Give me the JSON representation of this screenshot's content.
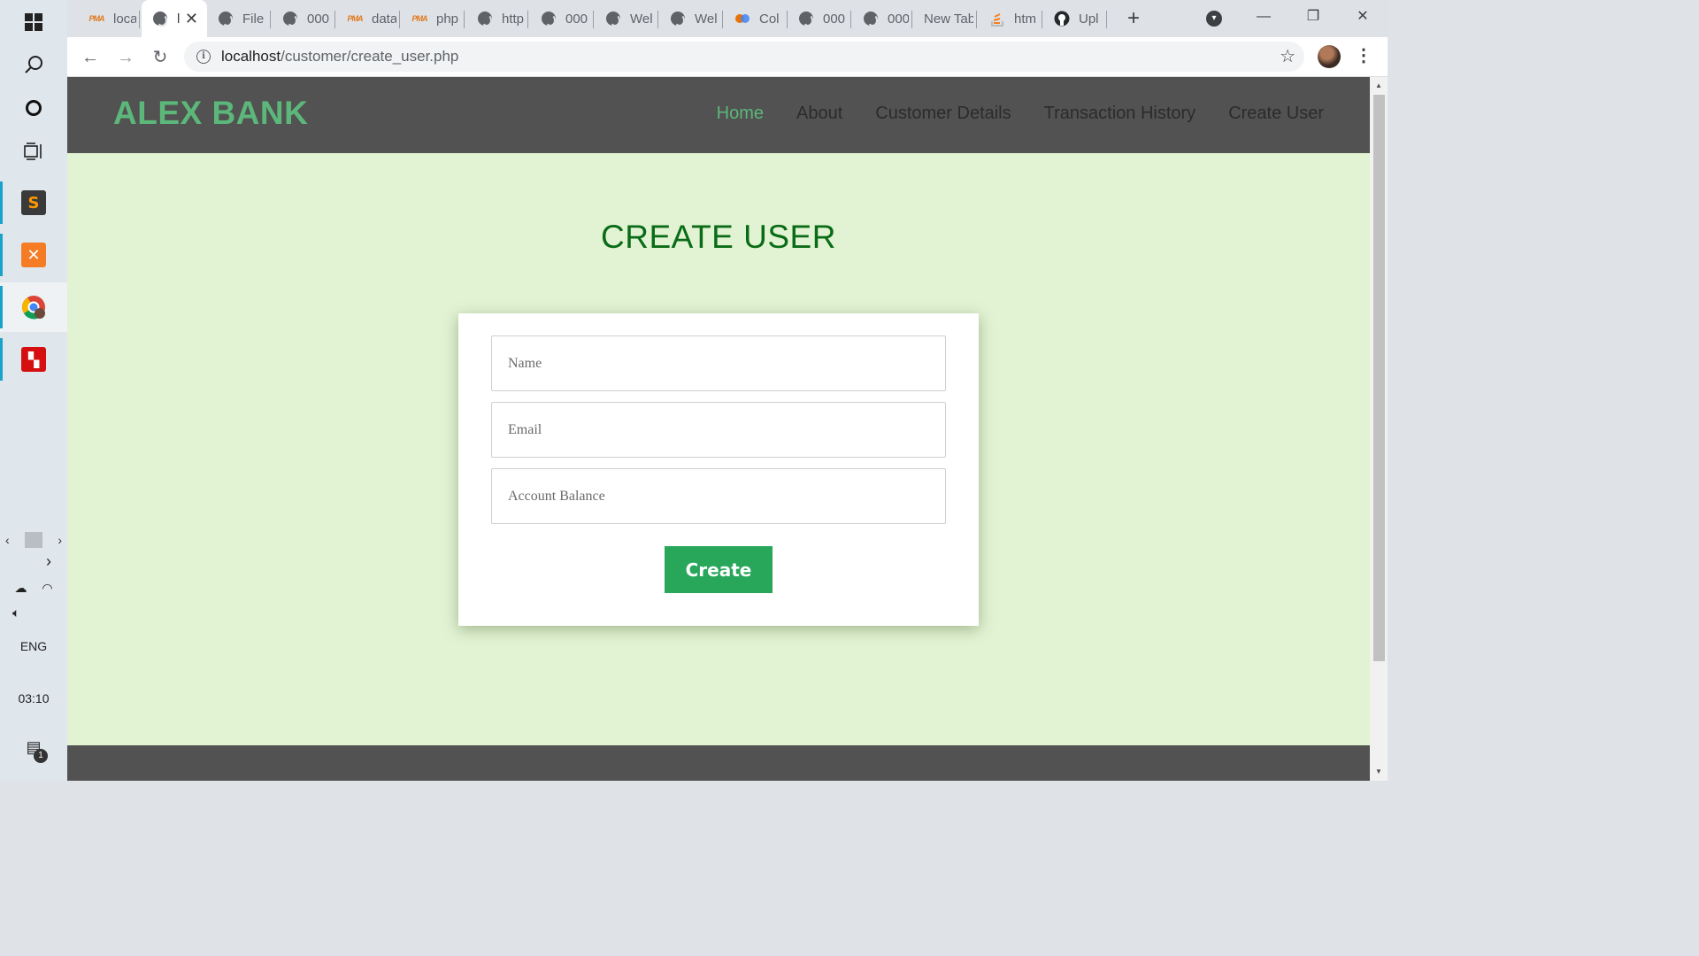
{
  "taskbar": {
    "tray_language": "ENG",
    "time": "03:10",
    "notification_count": "1"
  },
  "browser": {
    "tabs": [
      {
        "title": "loca",
        "icon": "phpmyadmin-icon"
      },
      {
        "title": "l",
        "icon": "globe-icon",
        "active": true
      },
      {
        "title": "File",
        "icon": "globe-icon"
      },
      {
        "title": "000",
        "icon": "globe-icon"
      },
      {
        "title": "data",
        "icon": "phpmyadmin-icon"
      },
      {
        "title": "php",
        "icon": "phpmyadmin-icon"
      },
      {
        "title": "http",
        "icon": "globe-icon"
      },
      {
        "title": "000",
        "icon": "globe-icon"
      },
      {
        "title": "Wel",
        "icon": "globe-icon"
      },
      {
        "title": "Wel",
        "icon": "globe-icon"
      },
      {
        "title": "Col",
        "icon": "colab-icon"
      },
      {
        "title": "000",
        "icon": "globe-icon"
      },
      {
        "title": "000",
        "icon": "globe-icon"
      },
      {
        "title": "New Tab",
        "icon": ""
      },
      {
        "title": "htm",
        "icon": "stackoverflow-icon"
      },
      {
        "title": "Upl",
        "icon": "github-icon"
      }
    ],
    "url_host": "localhost",
    "url_path": "/customer/create_user.php"
  },
  "site": {
    "brand": "ALEX BANK",
    "nav": [
      "Home",
      "About",
      "Customer Details",
      "Transaction History",
      "Create User"
    ],
    "active_nav": "Home",
    "accent_color": "#5cb77a"
  },
  "form": {
    "title": "CREATE USER",
    "name_placeholder": "Name",
    "email_placeholder": "Email",
    "balance_placeholder": "Account Balance",
    "submit_label": "Create",
    "submit_color": "#28a75b"
  }
}
